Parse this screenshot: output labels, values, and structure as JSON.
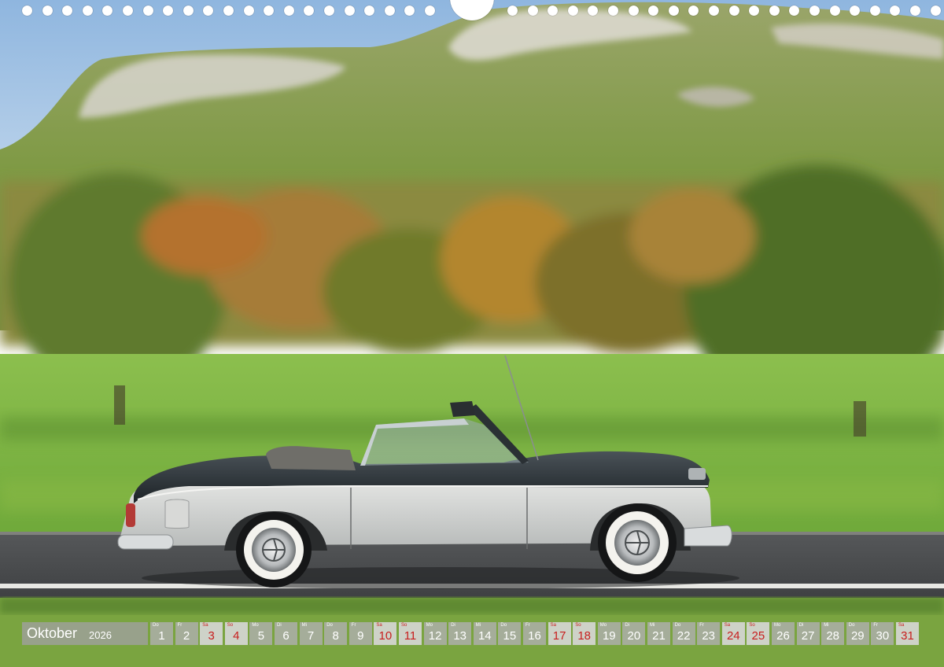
{
  "calendar": {
    "month": "Oktober",
    "year": "2026",
    "holiday_color": "#c81e1e",
    "days": [
      {
        "wd": "Do",
        "num": "1",
        "holiday": false
      },
      {
        "wd": "Fr",
        "num": "2",
        "holiday": false
      },
      {
        "wd": "Sa",
        "num": "3",
        "holiday": true
      },
      {
        "wd": "So",
        "num": "4",
        "holiday": true
      },
      {
        "wd": "Mo",
        "num": "5",
        "holiday": false
      },
      {
        "wd": "Di",
        "num": "6",
        "holiday": false
      },
      {
        "wd": "Mi",
        "num": "7",
        "holiday": false
      },
      {
        "wd": "Do",
        "num": "8",
        "holiday": false
      },
      {
        "wd": "Fr",
        "num": "9",
        "holiday": false
      },
      {
        "wd": "Sa",
        "num": "10",
        "holiday": true
      },
      {
        "wd": "So",
        "num": "11",
        "holiday": true
      },
      {
        "wd": "Mo",
        "num": "12",
        "holiday": false
      },
      {
        "wd": "Di",
        "num": "13",
        "holiday": false
      },
      {
        "wd": "Mi",
        "num": "14",
        "holiday": false
      },
      {
        "wd": "Do",
        "num": "15",
        "holiday": false
      },
      {
        "wd": "Fr",
        "num": "16",
        "holiday": false
      },
      {
        "wd": "Sa",
        "num": "17",
        "holiday": true
      },
      {
        "wd": "So",
        "num": "18",
        "holiday": true
      },
      {
        "wd": "Mo",
        "num": "19",
        "holiday": false
      },
      {
        "wd": "Di",
        "num": "20",
        "holiday": false
      },
      {
        "wd": "Mi",
        "num": "21",
        "holiday": false
      },
      {
        "wd": "Do",
        "num": "22",
        "holiday": false
      },
      {
        "wd": "Fr",
        "num": "23",
        "holiday": false
      },
      {
        "wd": "Sa",
        "num": "24",
        "holiday": true
      },
      {
        "wd": "So",
        "num": "25",
        "holiday": true
      },
      {
        "wd": "Mo",
        "num": "26",
        "holiday": false
      },
      {
        "wd": "Di",
        "num": "27",
        "holiday": false
      },
      {
        "wd": "Mi",
        "num": "28",
        "holiday": false
      },
      {
        "wd": "Do",
        "num": "29",
        "holiday": false
      },
      {
        "wd": "Fr",
        "num": "30",
        "holiday": false
      },
      {
        "wd": "Sa",
        "num": "31",
        "holiday": true
      }
    ]
  }
}
